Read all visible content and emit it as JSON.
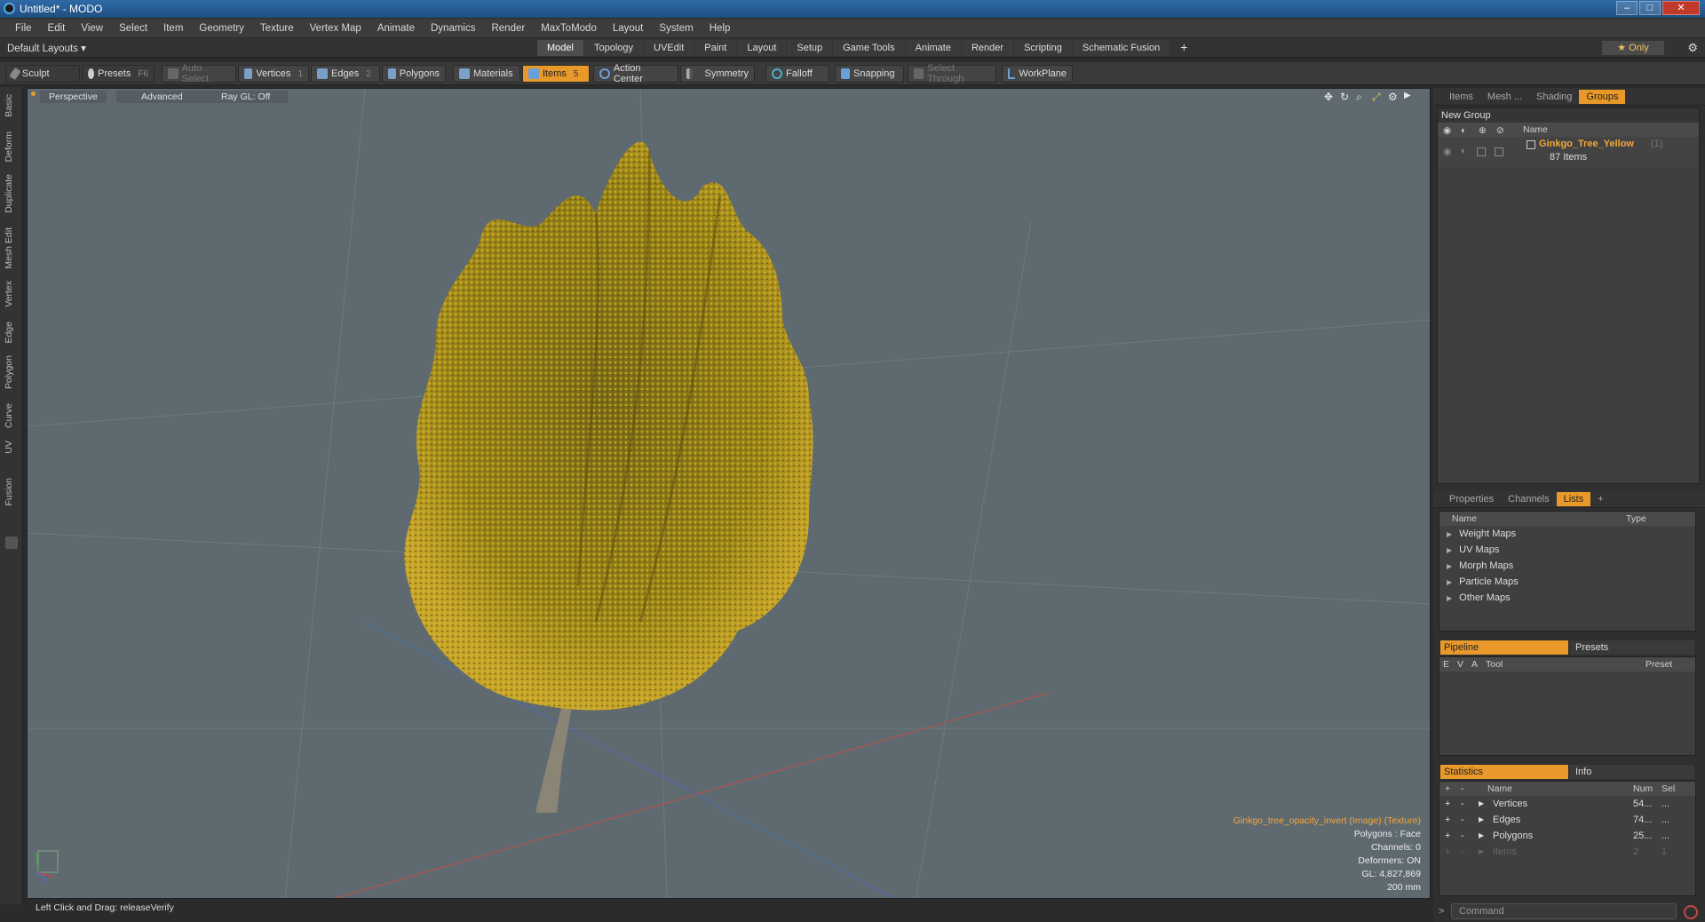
{
  "window": {
    "title": "Untitled* - MODO",
    "min": "‒",
    "max": "□",
    "close": "✕"
  },
  "menu": [
    "File",
    "Edit",
    "View",
    "Select",
    "Item",
    "Geometry",
    "Texture",
    "Vertex Map",
    "Animate",
    "Dynamics",
    "Render",
    "MaxToModo",
    "Layout",
    "System",
    "Help"
  ],
  "layouts": {
    "selector": "Default Layouts ▾",
    "tabs": [
      "Model",
      "Topology",
      "UVEdit",
      "Paint",
      "Layout",
      "Setup",
      "Game Tools",
      "Animate",
      "Render",
      "Scripting",
      "Schematic Fusion"
    ],
    "active": "Model",
    "add": "+",
    "only": "★ Only"
  },
  "toolbar": {
    "sculpt": "Sculpt",
    "presets": "Presets",
    "presets_key": "F6",
    "auto_select": "Auto Select",
    "vertices": "Vertices",
    "vertices_key": "1",
    "edges": "Edges",
    "edges_key": "2",
    "polygons": "Polygons",
    "materials": "Materials",
    "items": "Items",
    "items_key": "5",
    "action_center": "Action Center",
    "symmetry": "Symmetry",
    "falloff": "Falloff",
    "snapping": "Snapping",
    "select_through": "Select Through",
    "workplane": "WorkPlane"
  },
  "left_tabs": [
    "Basic",
    "Deform",
    "Duplicate",
    "Mesh Edit",
    "Vertex",
    "Edge",
    "Polygon",
    "Curve",
    "UV",
    "Fusion"
  ],
  "viewport": {
    "view": "Perspective",
    "shading": "Advanced",
    "raygl": "Ray GL: Off",
    "info": {
      "texture": "Ginkgo_tree_opacity_invert (Image) (Texture)",
      "polygons": "Polygons : Face",
      "channels": "Channels: 0",
      "deformers": "Deformers: ON",
      "gl": "GL: 4,827,869",
      "scale": "200 mm"
    }
  },
  "status": {
    "text": "Left Click and Drag:   releaseVerify"
  },
  "groups_panel": {
    "tabs": [
      "Items",
      "Mesh ...",
      "Shading",
      "Groups"
    ],
    "active": "Groups",
    "new_group": "New Group",
    "name_header": "Name",
    "group_name": "Ginkgo_Tree_Yellow",
    "group_count": "(1)",
    "group_items": "87 Items"
  },
  "lists_panel": {
    "tabs": [
      "Properties",
      "Channels",
      "Lists",
      "+"
    ],
    "active": "Lists",
    "name_header": "Name",
    "type_header": "Type",
    "rows": [
      "Weight Maps",
      "UV Maps",
      "Morph Maps",
      "Particle Maps",
      "Other Maps"
    ]
  },
  "pipeline_panel": {
    "tab_pipeline": "Pipeline",
    "tab_presets": "Presets",
    "headers": {
      "e": "E",
      "v": "V",
      "a": "A",
      "tool": "Tool",
      "preset": "Preset"
    }
  },
  "stats_panel": {
    "tab_statistics": "Statistics",
    "tab_info": "Info",
    "headers": {
      "plus": "+",
      "minus": "-",
      "name": "Name",
      "num": "Num",
      "sel": "Sel"
    },
    "rows": [
      {
        "name": "Vertices",
        "num": "54...",
        "sel": "..."
      },
      {
        "name": "Edges",
        "num": "74...",
        "sel": "..."
      },
      {
        "name": "Polygons",
        "num": "25...",
        "sel": "..."
      },
      {
        "name": "Items",
        "num": "2",
        "sel": "1"
      }
    ]
  },
  "command": {
    "placeholder": "Command"
  },
  "colors": {
    "accent": "#e8992a",
    "viewport_bg": "#5f6a70",
    "foliage": "#b08f1a",
    "trunk": "#8a8574"
  },
  "icons": [
    "sculpt-icon",
    "presets-icon",
    "vertices-icon",
    "edges-icon",
    "polygons-icon",
    "materials-icon",
    "items-icon",
    "action-center-icon",
    "symmetry-icon",
    "falloff-icon",
    "snapping-icon",
    "workplane-icon",
    "gear-icon",
    "eye-icon",
    "lock-icon"
  ]
}
